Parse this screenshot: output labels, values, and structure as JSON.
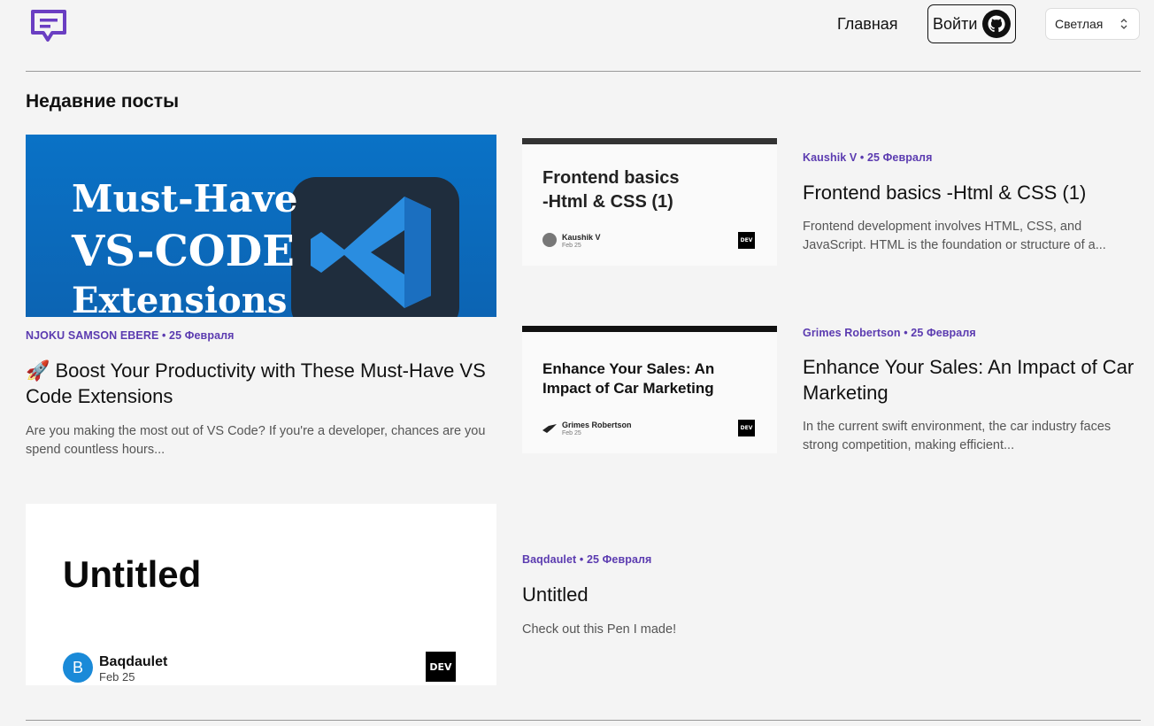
{
  "header": {
    "nav_home": "Главная",
    "login_label": "Войти",
    "theme_selected": "Светлая"
  },
  "section_title": "Недавние посты",
  "colors": {
    "accent": "#5b3bb0",
    "vs_blue": "#0b6cbf"
  },
  "posts": [
    {
      "meta": "NJOKU SAMSON EBERE • 25 Февраля",
      "title": "🚀 Boost Your Productivity with These Must-Have VS Code Extensions",
      "excerpt": "Are you making the most out of VS Code? If you're a developer, chances are you spend countless hours...",
      "thumb_lines": [
        "Must-Have",
        "VS-CODE",
        "Extensions"
      ]
    },
    {
      "meta": "Kaushik V • 25 Февраля",
      "title": "Frontend basics -Html & CSS (1)",
      "excerpt": "Frontend development involves HTML, CSS, and JavaScript. HTML is the foundation or structure of a...",
      "thumb_title_lines": [
        "Frontend basics",
        "-Html & CSS (1)"
      ],
      "thumb_author": "Kaushik V",
      "thumb_date": "Feb 25",
      "thumb_logo": "DEV"
    },
    {
      "meta": "Grimes Robertson • 25 Февраля",
      "title": "Enhance Your Sales: An Impact of Car Marketing",
      "excerpt": "In the current swift environment, the car industry faces strong competition, making efficient...",
      "thumb_title_lines": [
        "Enhance Your Sales: An",
        "Impact of Car Marketing"
      ],
      "thumb_author": "Grimes Robertson",
      "thumb_date": "Feb 25",
      "thumb_logo": "DEV"
    },
    {
      "meta": "Baqdaulet • 25 Февраля",
      "title": "Untitled",
      "excerpt": "Check out this Pen I made!",
      "thumb_title": "Untitled",
      "thumb_author": "Baqdaulet",
      "thumb_date": "Feb 25",
      "thumb_avatar_letter": "B",
      "thumb_logo": "DEV"
    }
  ]
}
